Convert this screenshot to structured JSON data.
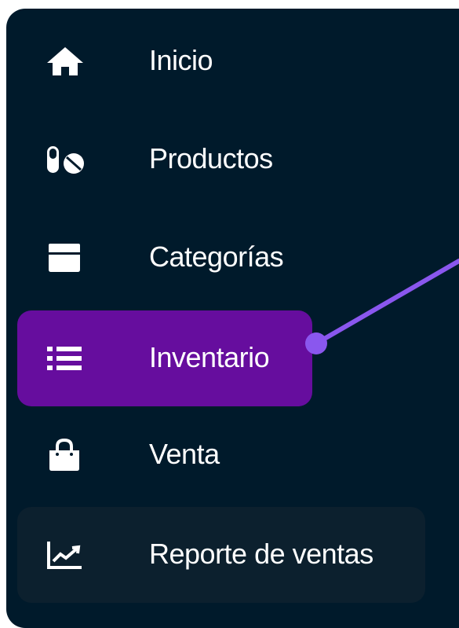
{
  "colors": {
    "sidebar_bg": "#001a2b",
    "active_bg": "#660d9e",
    "hover_bg": "#0c202e",
    "text": "#ffffff",
    "connector": "#8a57ee"
  },
  "sidebar": {
    "items": [
      {
        "label": "Inicio",
        "icon": "home-icon",
        "state": "default"
      },
      {
        "label": "Productos",
        "icon": "pills-icon",
        "state": "default"
      },
      {
        "label": "Categorías",
        "icon": "box-icon",
        "state": "default"
      },
      {
        "label": "Inventario",
        "icon": "list-icon",
        "state": "active"
      },
      {
        "label": "Venta",
        "icon": "shopping-bag-icon",
        "state": "default"
      },
      {
        "label": "Reporte de ventas",
        "icon": "line-chart-icon",
        "state": "hovered"
      }
    ]
  }
}
